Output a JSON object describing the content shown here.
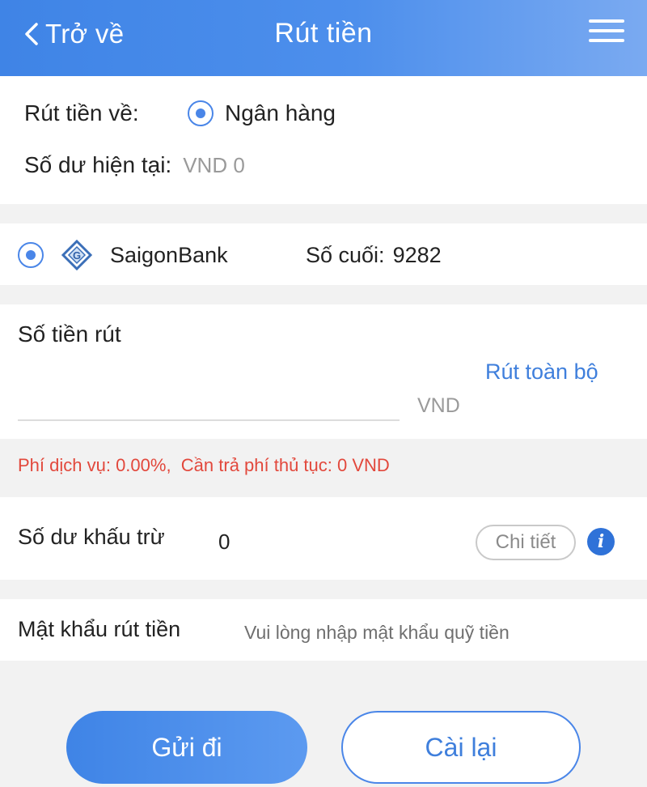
{
  "header": {
    "back_label": "Trở về",
    "title": "Rút tiền",
    "menu_icon": "hamburger-menu-icon"
  },
  "withdraw_to": {
    "label": "Rút tiền về:",
    "option": "Ngân hàng"
  },
  "balance": {
    "label": "Số dư hiện tại:",
    "value": "VND 0"
  },
  "bank": {
    "name": "SaigonBank",
    "last_digits_label": "Số cuối:",
    "last_digits": "9282",
    "logo_icon": "saigonbank-logo-icon"
  },
  "amount": {
    "label": "Số tiền rút",
    "withdraw_all": "Rút toàn bộ",
    "value": "",
    "currency": "VND"
  },
  "fee": {
    "text": "Phí dịch vụ: 0.00%,  Cần trả phí thủ tục: 0 VND"
  },
  "deduction": {
    "label": "Số dư khấu trừ",
    "value": "0",
    "detail_button": "Chi tiết",
    "info_icon": "info-icon"
  },
  "password": {
    "label": "Mật khẩu rút tiền",
    "placeholder": "Vui lòng nhập mật khẩu quỹ tiền",
    "value": ""
  },
  "actions": {
    "submit": "Gửi đi",
    "reset": "Cài lại"
  },
  "colors": {
    "primary": "#4a86e8",
    "fee_text": "#e2483c",
    "background": "#f2f2f2"
  }
}
